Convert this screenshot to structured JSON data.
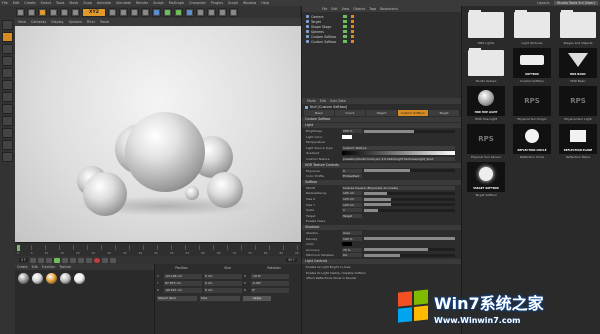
{
  "menubar": {
    "items": [
      "File",
      "Edit",
      "Create",
      "Select",
      "Tools",
      "Mesh",
      "Snap",
      "Animate",
      "Simulate",
      "Render",
      "Sculpt",
      "MoGraph",
      "Character",
      "Plugins",
      "Script",
      "Window",
      "Help"
    ],
    "layout_label": "Layout:",
    "layout_value": "Studio Tools 5nl (User)"
  },
  "toolbar": {
    "xyz_label": "XYZ"
  },
  "viewport_menu": [
    "View",
    "Cameras",
    "Display",
    "Options",
    "Filter",
    "Panel"
  ],
  "timeline": {
    "ticks": [
      "0",
      "5",
      "10",
      "15",
      "20",
      "25",
      "30",
      "35",
      "40",
      "45",
      "50",
      "55",
      "60",
      "65",
      "70",
      "75",
      "80",
      "85",
      "90"
    ]
  },
  "transport": {
    "current_frame": "0 F",
    "end_frame": "90 F"
  },
  "material_manager": {
    "menu": [
      "Create",
      "Edit",
      "Function",
      "Texture"
    ],
    "materials": [
      {
        "color": "#9a9a9a"
      },
      {
        "color": "#d8d8d8"
      },
      {
        "color": "#e6a33a"
      },
      {
        "color": "#bfbfbf"
      },
      {
        "color": "#eeeeee"
      }
    ]
  },
  "coordinates": {
    "headers": [
      "Position",
      "Size",
      "Rotation"
    ],
    "rows": [
      {
        "axis": "X",
        "position": "-23.146 cm",
        "size": "0 cm",
        "rot_label": "H",
        "rotation": "-72.6°"
      },
      {
        "axis": "Y",
        "position": "67.875 cm",
        "size": "0 cm",
        "rot_label": "P",
        "rotation": "-5.99°"
      },
      {
        "axis": "Z",
        "position": "-90.527 cm",
        "size": "0 cm",
        "rot_label": "B",
        "rotation": "0°"
      }
    ],
    "mode": "Object (Rel)",
    "size_mode": "Size",
    "apply": "Apply"
  },
  "object_manager": {
    "menu": [
      "File",
      "Edit",
      "View",
      "Objects",
      "Tags",
      "Bookmarks"
    ],
    "objects": [
      "Camera",
      "Target",
      "Shape Stage",
      "Spheres",
      "Custom Softbox",
      "Custom Softbox"
    ]
  },
  "attribute_manager": {
    "menu": [
      "Mode",
      "Edit",
      "User Data"
    ],
    "title": "Null [Custom Softbox]",
    "tabs": [
      "Basic",
      "Coord.",
      "Object",
      "Custom Softbox",
      "Target"
    ],
    "sections": {
      "custom_softbox": "Custom Softbox",
      "light": "Light",
      "hdri_texture": "HDR Texture Controls",
      "softbox": "Softbox",
      "shadows": "Shadows",
      "physical": "Physical Sky Preset",
      "light_controls": "Light Controls"
    },
    "rows": {
      "brightness_label": "Brightness",
      "brightness_value": "200 %",
      "light_color_label": "Light Color",
      "temp_label": "Temperature",
      "light_source_type_label": "Light Source Type",
      "light_source_type_value": "Custom Texture",
      "gradient_label": "Gradient",
      "softbox_texture_label": "Custom Texture",
      "softbox_texture_value": "presets://studio tools pro 2.0.lib4d/Light Textures/Light_Spot",
      "exposure_label": "Exposure",
      "exposure_value": "0",
      "color_profile_label": "Color Profile",
      "color_profile_value": "Embedded",
      "falloff_label": "Falloff",
      "falloff_value": "Inverse Square (Physically Accurate)",
      "radius_label": "Radius/Decay",
      "radius_value": "105 cm",
      "size_x_label": "Size X",
      "size_x_value": "125 cm",
      "size_y_label": "Size Y",
      "size_y_value": "125 cm",
      "scale_label": "Scale",
      "scale_value": "1",
      "target_label": "Target",
      "target_value": "Target",
      "enable_label": "Enable Valve",
      "shadow_label": "Shadow",
      "shadow_value": "Area",
      "density_label": "Density",
      "density_value": "100 %",
      "color_label": "Color",
      "accuracy_label": "Accuracy",
      "accuracy_value": "70 %",
      "min_samples_label": "Minimum Samples",
      "min_samples_value": "64",
      "lc_row1": "Enable GI Light   Bright in Area",
      "lc_row2": "Enable GI Light   Visible / Disable Softbox",
      "lc_row3": "Affect Reflections   Show in Render"
    },
    "progress": {
      "brightness": 0.55,
      "exposure": 0.5,
      "radius": 0.25,
      "size_x": 0.3,
      "size_y": 0.3,
      "scale": 0.15,
      "density": 1.0,
      "accuracy": 0.7,
      "min_samples": 0.4
    }
  },
  "content_browser": {
    "tiles": [
      {
        "kind": "folder",
        "caption": "HDR Lights"
      },
      {
        "kind": "folder",
        "caption": "Light Textures"
      },
      {
        "kind": "folder",
        "caption": "Stages and Objects"
      },
      {
        "kind": "folder",
        "caption": "Studio Setups"
      },
      {
        "kind": "softbox",
        "caption": "Custom Softbox",
        "inner": "SOFTBOX"
      },
      {
        "kind": "spot",
        "caption": "HDR Basic",
        "inner": "HDR BASIC"
      },
      {
        "kind": "sphere",
        "caption": "HDR Hue Light",
        "inner": "HDR HUE LIGHT"
      },
      {
        "kind": "rps",
        "caption": "Physical Sun Plugin",
        "inner": "RPS"
      },
      {
        "kind": "rps",
        "caption": "Physical Sun Light",
        "inner": "RPS"
      },
      {
        "kind": "rps",
        "caption": "Physical Sun Sensor",
        "inner": "RPS"
      },
      {
        "kind": "circle",
        "caption": "Reflection Circle",
        "inner": "REFLECTION CIRCLE"
      },
      {
        "kind": "plane",
        "caption": "Reflection Plane",
        "inner": "REFLECTION PLANE"
      },
      {
        "kind": "target",
        "caption": "Target Softbox",
        "inner": "TARGET SOFTBOX"
      }
    ]
  },
  "watermark": {
    "brand": "Win7系统之家",
    "url": "Www.Winwin7.com",
    "colors": [
      "#f25022",
      "#7fba00",
      "#00a4ef",
      "#ffb900"
    ]
  }
}
